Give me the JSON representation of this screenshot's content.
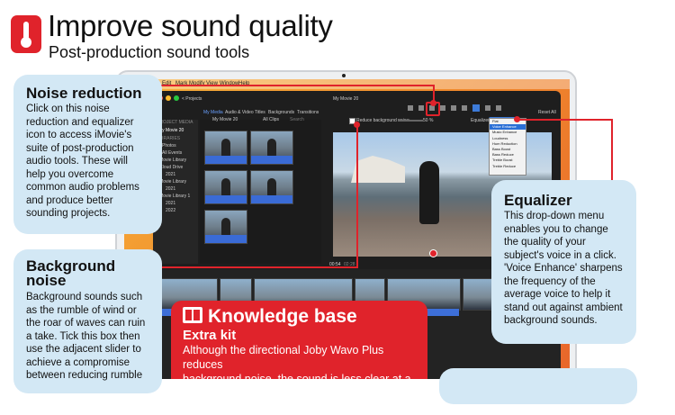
{
  "header": {
    "title": "Improve sound quality",
    "subtitle": "Post-production sound tools",
    "icon": "thermometer-icon"
  },
  "mac_menu": {
    "items": [
      "Edit",
      "Mark",
      "Modify",
      "View",
      "Window",
      "Help"
    ]
  },
  "imovie": {
    "projects_label": "< Projects",
    "movie_title": "My Movie 20",
    "tabs": [
      "My Media",
      "Audio & Video",
      "Titles",
      "Backgrounds",
      "Transitions"
    ],
    "library_header": "PROJECT MEDIA",
    "libraries_header": "LIBRARIES",
    "sidebar_items": [
      "My Movie 20",
      "Photos",
      "All Events",
      "iMovie Library",
      "iCloud Drive",
      "2021",
      "iMovie Library",
      "2021",
      "iMovie Library 1",
      "2021",
      "2022"
    ],
    "browser_project": "My Movie 20",
    "clips_filter": "All Clips",
    "search_placeholder": "Search",
    "reduce_noise_label": "Reduce background noise:",
    "reduce_noise_value": "50 %",
    "equalizer_label": "Equalizer:",
    "equalizer_value": "Flat",
    "reset_all": "Reset All",
    "equalizer_options": [
      "Flat",
      "Voice Enhance",
      "Music Enhance",
      "Loudness",
      "Hum Reduction",
      "Bass Boost",
      "Bass Reduce",
      "Treble Boost",
      "Treble Reduce"
    ],
    "timecode": "00:54",
    "timecode_total": "02:28"
  },
  "callouts": {
    "noise_reduction": {
      "title": "Noise reduction",
      "text": "Click on this noise\nreduction and equalizer\nicon to access iMovie's\nsuite of post-production\naudio tools. These will\nhelp you overcome\ncommon audio problems\nand produce better\nsounding projects."
    },
    "background_noise": {
      "title_line1": "Background",
      "title_line2": "noise",
      "text": "Background sounds such\nas the rumble of wind or\nthe roar of waves can ruin\na take. Tick this box then\nuse the adjacent slider to\nachieve a compromise\nbetween reducing rumble"
    },
    "equalizer": {
      "title": "Equalizer",
      "text": "This drop-down menu\nenables you to change\nthe quality of your\nsubject's voice in a click.\n'Voice Enhance' sharpens\nthe frequency of the\naverage voice to help it\nstand out against ambient\nbackground sounds."
    }
  },
  "knowledge_base": {
    "title": "Knowledge base",
    "subtitle": "Extra kit",
    "text": "Although the directional Joby Wavo Plus reduces\nbackground noise, the sound is less clear at a\ndistance. The best results come from the SmallRig"
  },
  "colors": {
    "accent_red": "#e0232b",
    "bubble_blue": "#d3e8f5",
    "wallpaper_orange": "#f08a2c"
  }
}
